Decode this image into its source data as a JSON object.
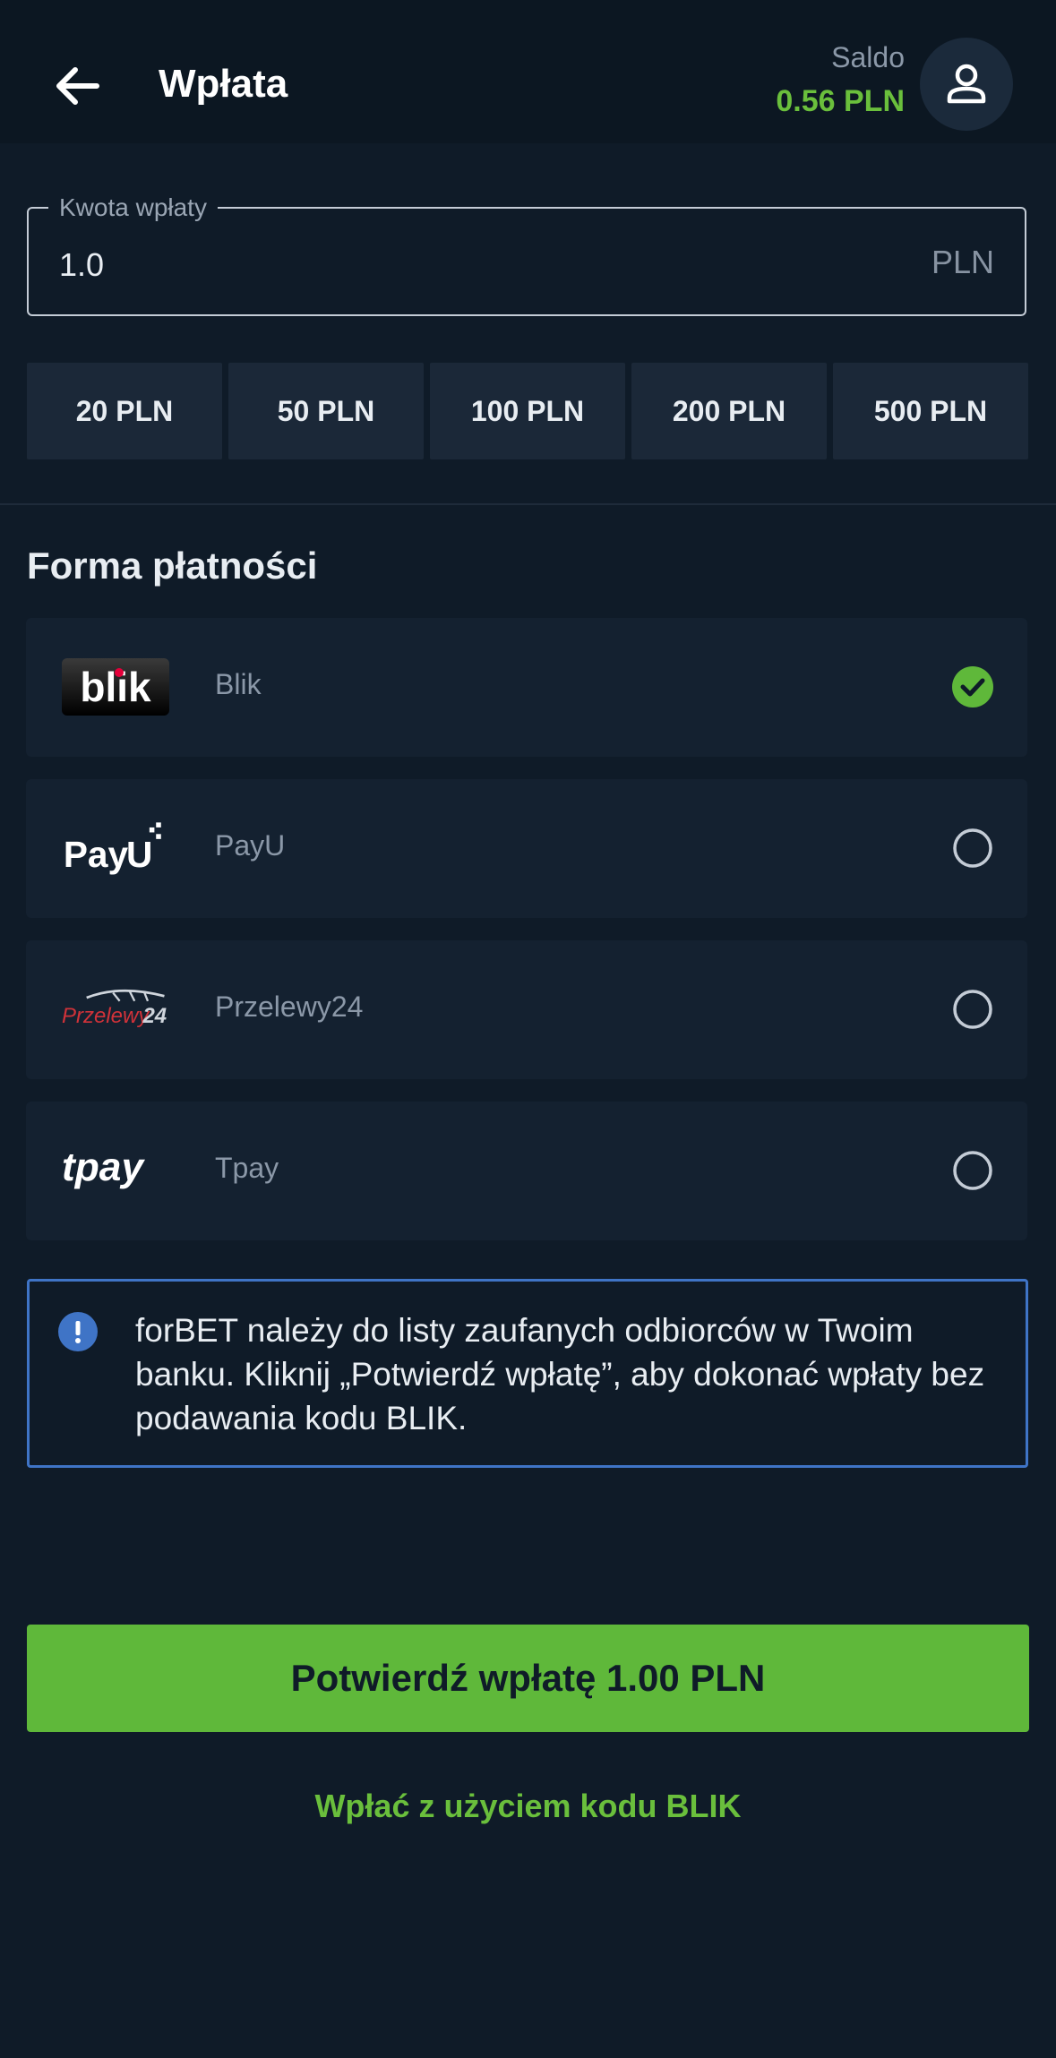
{
  "header": {
    "title": "Wpłata",
    "balance_label": "Saldo",
    "balance_value": "0.56 PLN"
  },
  "amount": {
    "label": "Kwota wpłaty",
    "value": "1.0",
    "currency": "PLN"
  },
  "quick_amounts": [
    "20 PLN",
    "50 PLN",
    "100 PLN",
    "200 PLN",
    "500 PLN"
  ],
  "payment": {
    "section_title": "Forma płatności",
    "methods": [
      {
        "name": "Blik",
        "selected": true
      },
      {
        "name": "PayU",
        "selected": false
      },
      {
        "name": "Przelewy24",
        "selected": false
      },
      {
        "name": "Tpay",
        "selected": false
      }
    ]
  },
  "info": {
    "text": "forBET należy do listy zaufanych odbiorców w Twoim banku. Kliknij „Potwierdź wpłatę”, aby dokonać wpłaty bez podawania kodu BLIK."
  },
  "actions": {
    "confirm_label": "Potwierdź wpłatę 1.00 PLN",
    "blik_code_label": "Wpłać z użyciem kodu BLIK"
  },
  "colors": {
    "accent_green": "#5fb83a",
    "info_border": "#3f74c6",
    "background": "#0f1b28"
  }
}
